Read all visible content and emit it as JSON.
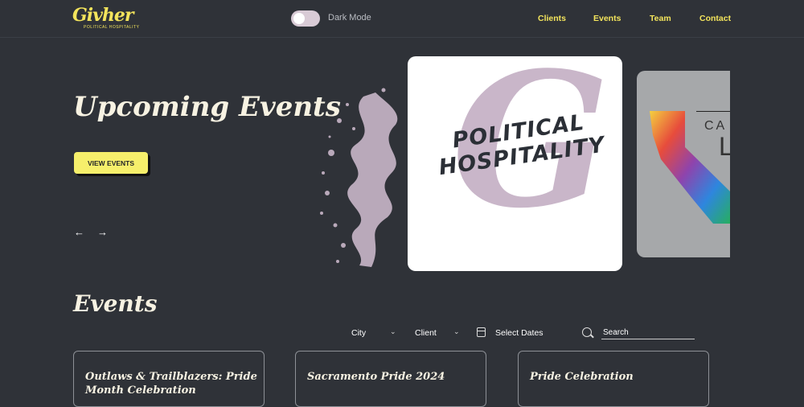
{
  "header": {
    "logo": {
      "word": "Givher",
      "tagline": "POLITICAL HOSPITALITY"
    },
    "dark_mode_label": "Dark Mode",
    "nav": [
      {
        "label": "Clients"
      },
      {
        "label": "Events"
      },
      {
        "label": "Team"
      },
      {
        "label": "Contact"
      }
    ]
  },
  "hero": {
    "title": "Upcoming Events",
    "button_label": "VIEW EVENTS",
    "prev_arrow": "←",
    "next_arrow": "→",
    "slide_main": {
      "big_letter": "G",
      "line1": "POLITICAL",
      "line2": "HOSPITALITY"
    },
    "slide_next": {
      "text1": "CA",
      "text2": "L"
    }
  },
  "events": {
    "title": "Events",
    "filters": {
      "city": "City",
      "client": "Client",
      "dates": "Select Dates",
      "search_placeholder": "Search"
    },
    "cards": [
      {
        "title": "Outlaws & Trailblazers: Pride Month Celebration"
      },
      {
        "title": "Sacramento Pride 2024"
      },
      {
        "title": "Pride Celebration"
      }
    ]
  },
  "colors": {
    "background": "#2f3238",
    "accent_yellow": "#f3e45c",
    "button_yellow": "#f6ef6b",
    "mauve": "#c9b6c9"
  }
}
